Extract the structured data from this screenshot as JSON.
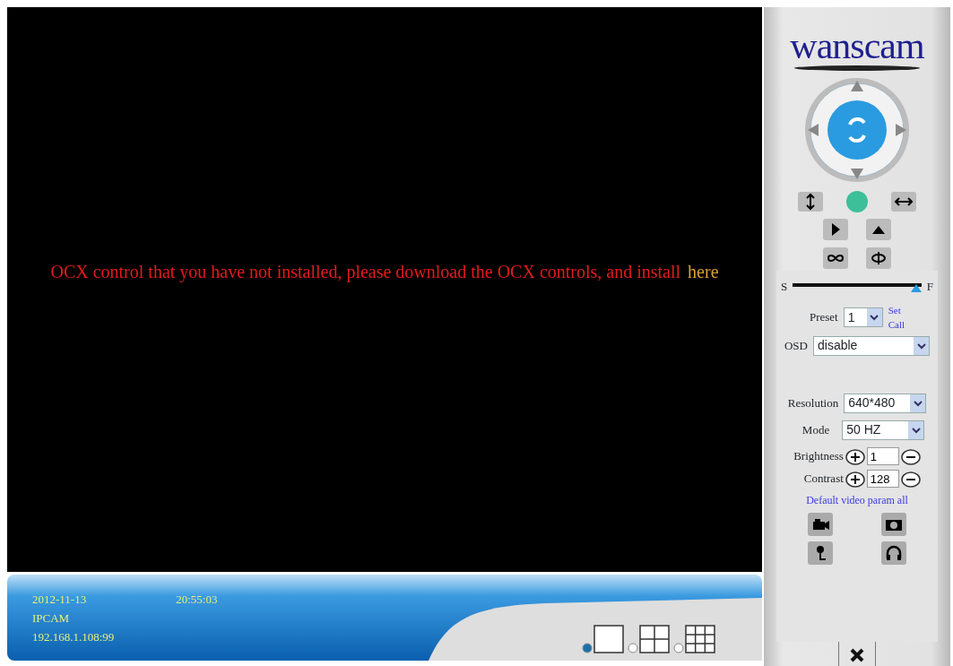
{
  "video": {
    "message": "OCX control that you have not installed, please download the OCX controls, and install",
    "link": "here"
  },
  "status": {
    "date": "2012-11-13",
    "time": "20:55:03",
    "name": "IPCAM",
    "address": "192.168.1.108:99"
  },
  "layouts": [
    {
      "kind": "single",
      "selected": true
    },
    {
      "kind": "quad",
      "selected": false
    },
    {
      "kind": "nine",
      "selected": false
    }
  ],
  "panel": {
    "logo": "wanscam",
    "speed": {
      "low": "S",
      "high": "F",
      "level": 1.0
    },
    "preset": {
      "label": "Preset",
      "value": "1",
      "set": "Set",
      "call": "Call"
    },
    "osd": {
      "label": "OSD",
      "value": "disable"
    },
    "resolution": {
      "label": "Resolution",
      "value": "640*480"
    },
    "mode": {
      "label": "Mode",
      "value": "50 HZ"
    },
    "brightness": {
      "label": "Brightness",
      "value": "1"
    },
    "contrast": {
      "label": "Contrast",
      "value": "128"
    },
    "default_link": "Default video param all"
  }
}
